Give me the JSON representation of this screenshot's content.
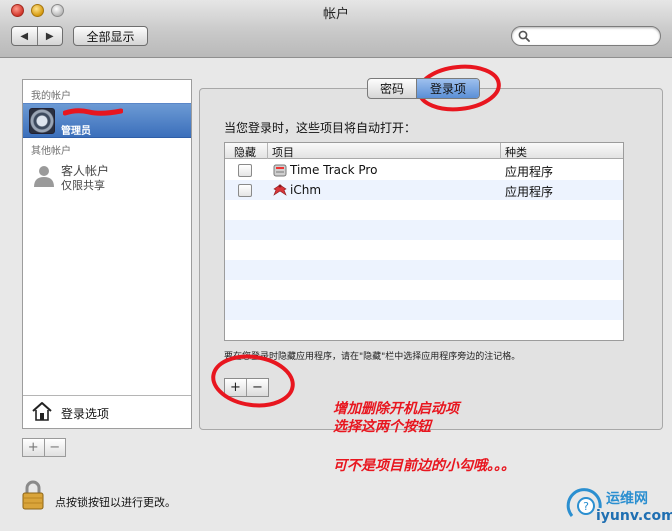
{
  "window": {
    "title": "帐户"
  },
  "toolbar": {
    "back_glyph": "◀",
    "forward_glyph": "▶",
    "show_all": "全部显示",
    "search": {
      "value": "",
      "placeholder": ""
    }
  },
  "sidebar": {
    "my_accounts_label": "我的帐户",
    "admin": {
      "role": "管理员"
    },
    "other_accounts_label": "其他帐户",
    "guest": {
      "name": "客人帐户",
      "subtitle": "仅限共享"
    },
    "login_options": "登录选项",
    "add": "+",
    "remove": "−"
  },
  "tabs": [
    {
      "label": "密码"
    },
    {
      "label": "登录项",
      "selected": true
    }
  ],
  "login_items": {
    "heading": "当您登录时，这些项目将自动打开：",
    "columns": {
      "hide": "隐藏",
      "item": "项目",
      "kind": "种类"
    },
    "rows": [
      {
        "name": "Time Track Pro",
        "kind": "应用程序",
        "hidden": false,
        "icon": "time-track-pro-icon"
      },
      {
        "name": "iChm",
        "kind": "应用程序",
        "hidden": false,
        "icon": "ichm-icon"
      }
    ],
    "hint": "要在您登录时隐藏应用程序，请在\"隐藏\"栏中选择应用程序旁边的注记格。",
    "add": "+",
    "remove": "−"
  },
  "lock": {
    "label": "点按锁按钮以进行更改。"
  },
  "annotations": {
    "line1": "增加删除开机启动项",
    "line2": "选择这两个按钮",
    "line3": "可不是项目前边的小勾哦。。。",
    "color": "#e8161f"
  },
  "watermark": {
    "name": "运维网",
    "url": "iyunv.com"
  },
  "colors": {
    "selection": "#3b6fbb",
    "tab_selected": "#5b8fd6",
    "row_alt": "#edf3fe"
  }
}
